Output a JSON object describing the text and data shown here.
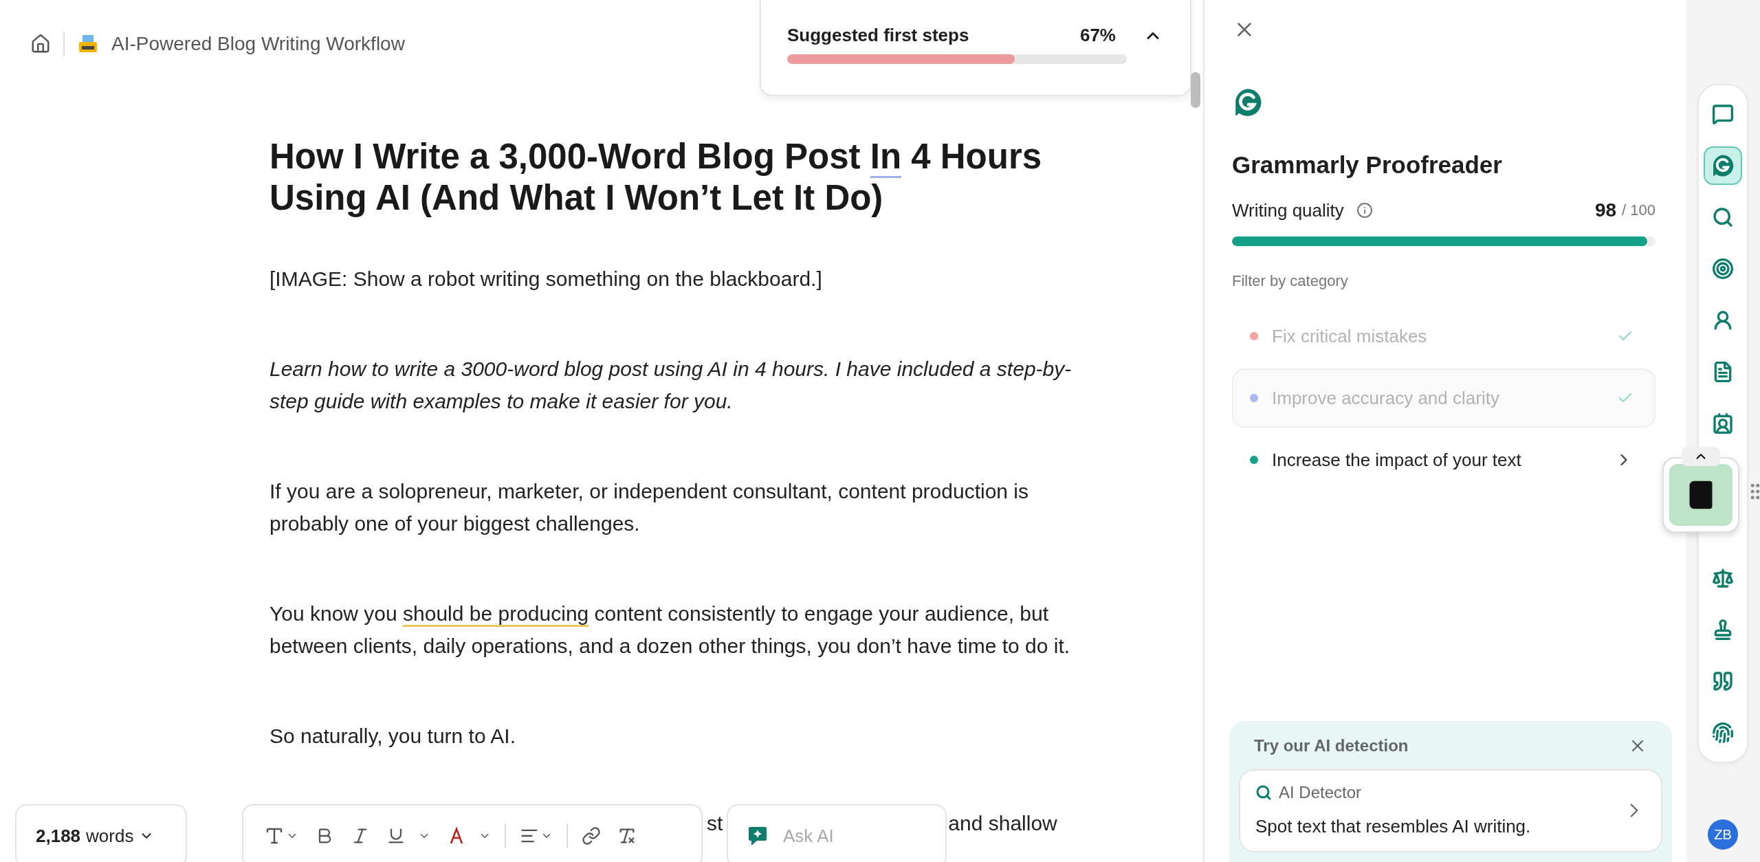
{
  "header": {
    "title": "AI-Powered Blog Writing Workflow"
  },
  "suggested_steps": {
    "title": "Suggested first steps",
    "percent": "67%",
    "level": 0.67
  },
  "document": {
    "heading": [
      {
        "text": "How I Write a 3,000-Word Blog Post ",
        "kind": "plain"
      },
      {
        "text": "In",
        "kind": "clarity"
      },
      {
        "text": " 4 Hours Using AI (And What I Won’t Let It Do)",
        "kind": "plain"
      }
    ],
    "paragraphs": [
      {
        "kind": "plain",
        "segments": [
          {
            "text": "[IMAGE: Show a robot writing something on the blackboard.]",
            "kind": "plain"
          }
        ]
      },
      {
        "kind": "italic",
        "segments": [
          {
            "text": "Learn how to write a 3000-word blog post using AI in 4 hours. I have included a step-by-step guide with examples to make it easier for you.",
            "kind": "plain"
          }
        ]
      },
      {
        "kind": "plain",
        "segments": [
          {
            "text": "If you are a solopreneur, marketer, or independent consultant, content production is probably one of your biggest challenges.",
            "kind": "plain"
          }
        ]
      },
      {
        "kind": "plain",
        "segments": [
          {
            "text": "You know you ",
            "kind": "plain"
          },
          {
            "text": "should be producing",
            "kind": "engagement"
          },
          {
            "text": " content consistently to engage your audience, but between clients, daily operations, and a dozen other things, you don’t have time to do it.",
            "kind": "plain"
          }
        ]
      },
      {
        "kind": "plain",
        "segments": [
          {
            "text": "So naturally, you turn to AI.",
            "kind": "plain"
          }
        ]
      }
    ],
    "partial_line": [
      "st",
      "and shallow"
    ]
  },
  "word_count": {
    "count": "2,188",
    "label": "words"
  },
  "ask_ai": {
    "placeholder": "Ask AI"
  },
  "panel": {
    "title": "Grammarly Proofreader",
    "quality_label": "Writing quality",
    "score": "98",
    "score_max": "/ 100",
    "level": 0.98,
    "filter_label": "Filter by category",
    "categories": [
      {
        "label": "Fix critical mistakes",
        "color": "#f4a3a3",
        "done": true,
        "selected": false
      },
      {
        "label": "Improve accuracy and clarity",
        "color": "#a9b8ee",
        "done": true,
        "selected": true
      },
      {
        "label": "Increase the impact of your text",
        "color": "#15a08a",
        "done": false,
        "selected": false
      }
    ],
    "ai_detection": {
      "title": "Try our AI detection",
      "tool": "AI Detector",
      "description": "Spot text that resembles AI writing."
    }
  },
  "rail": [
    {
      "kind": "chat",
      "selected": false
    },
    {
      "kind": "grammarly",
      "selected": true
    },
    {
      "kind": "search",
      "selected": false
    },
    {
      "kind": "target",
      "selected": false
    },
    {
      "kind": "person",
      "selected": false
    },
    {
      "kind": "rewrite",
      "selected": false
    },
    {
      "kind": "reader",
      "selected": false
    },
    {
      "kind": "scale",
      "selected": false
    },
    {
      "kind": "stamp",
      "selected": false
    },
    {
      "kind": "quote",
      "selected": false
    },
    {
      "kind": "fingerprint",
      "selected": false
    }
  ],
  "avatar": {
    "initials": "ZB"
  }
}
